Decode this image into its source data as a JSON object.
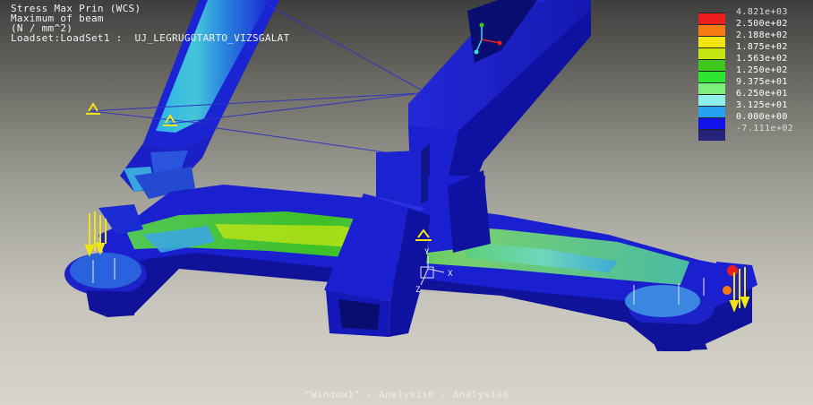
{
  "header": {
    "line1": "Stress Max Prin (WCS)",
    "line2": "Maximum of beam",
    "line3": "(N / mm^2)",
    "line4": "Loadset:LoadSet1 :  UJ_LEGRUGOTARTO_VIZSGALAT"
  },
  "legend": {
    "entries": [
      {
        "label": "4.821e+03",
        "color": "#ee1d1d",
        "text_color": "#dcdcdc"
      },
      {
        "label": "2.500e+02",
        "color": "#f57a12",
        "text_color": "#ffffff"
      },
      {
        "label": "2.188e+02",
        "color": "#f2e612",
        "text_color": "#ffffff"
      },
      {
        "label": "1.875e+02",
        "color": "#c6e612",
        "text_color": "#ffffff"
      },
      {
        "label": "1.563e+02",
        "color": "#3ec81e",
        "text_color": "#ffffff"
      },
      {
        "label": "1.250e+02",
        "color": "#2ee632",
        "text_color": "#ffffff"
      },
      {
        "label": "9.375e+01",
        "color": "#7cf07a",
        "text_color": "#ffffff"
      },
      {
        "label": "6.250e+01",
        "color": "#8ef0ea",
        "text_color": "#ffffff"
      },
      {
        "label": "3.125e+01",
        "color": "#28a2f0",
        "text_color": "#ffffff"
      },
      {
        "label": "0.000e+00",
        "color": "#1212ea",
        "text_color": "#ffffff"
      },
      {
        "label": "-7.111e+02",
        "color": "#242478",
        "text_color": "#dcdcdc"
      }
    ]
  },
  "footer": {
    "text": "\"Window1\" - Analysis0 - Analysis0"
  },
  "triad": {
    "x_label": "X",
    "y_label": "Y",
    "z_label": "Z"
  },
  "colors": {
    "mesh_blue": "#1a1fd0",
    "mesh_dark": "#10139a",
    "mesh_light": "#3a5ae0",
    "constraint": "#f2e612",
    "load_line": "#3535c0",
    "csys": "#38e0e0"
  }
}
